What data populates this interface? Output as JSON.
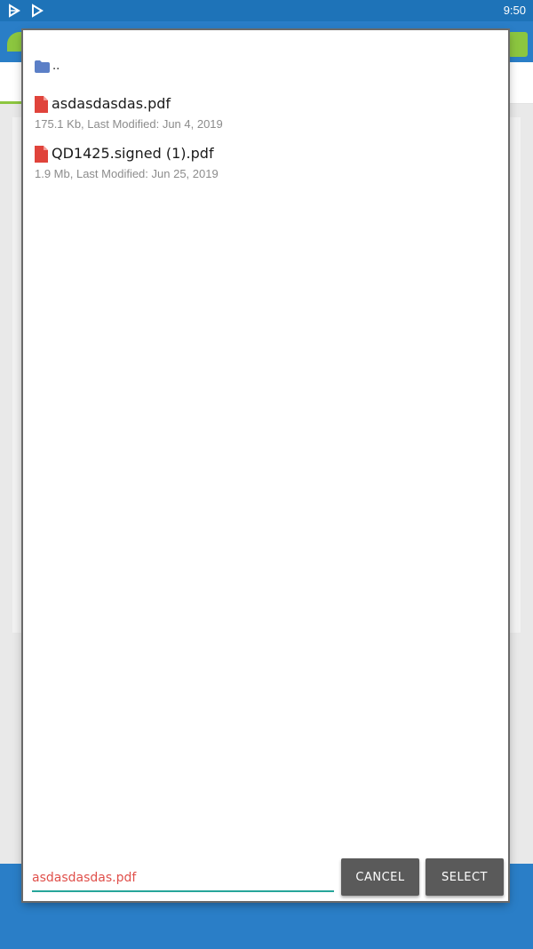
{
  "status_bar": {
    "time": "9:50",
    "icons": [
      "play-store-icon",
      "play-icon"
    ]
  },
  "colors": {
    "status_bar": "#1e73b8",
    "app_primary": "#2a7ec7",
    "accent_green": "#8cc63f",
    "folder_blue": "#5b7fc7",
    "pdf_red": "#e0433b",
    "field_underline": "#26a69a",
    "field_text": "#e0504b",
    "button_bg": "#5a5a5a"
  },
  "dialog": {
    "parent_dir": {
      "label": "..",
      "icon": "folder-icon"
    },
    "files": [
      {
        "name": "asdasdasdas.pdf",
        "meta": "175.1 Kb, Last Modified: Jun 4, 2019",
        "icon": "pdf-icon"
      },
      {
        "name": "QD1425.signed (1).pdf",
        "meta": "1.9 Mb, Last Modified: Jun 25, 2019",
        "icon": "pdf-icon"
      }
    ],
    "filename_value": "asdasdasdas.pdf",
    "cancel_label": "CANCEL",
    "select_label": "SELECT"
  }
}
